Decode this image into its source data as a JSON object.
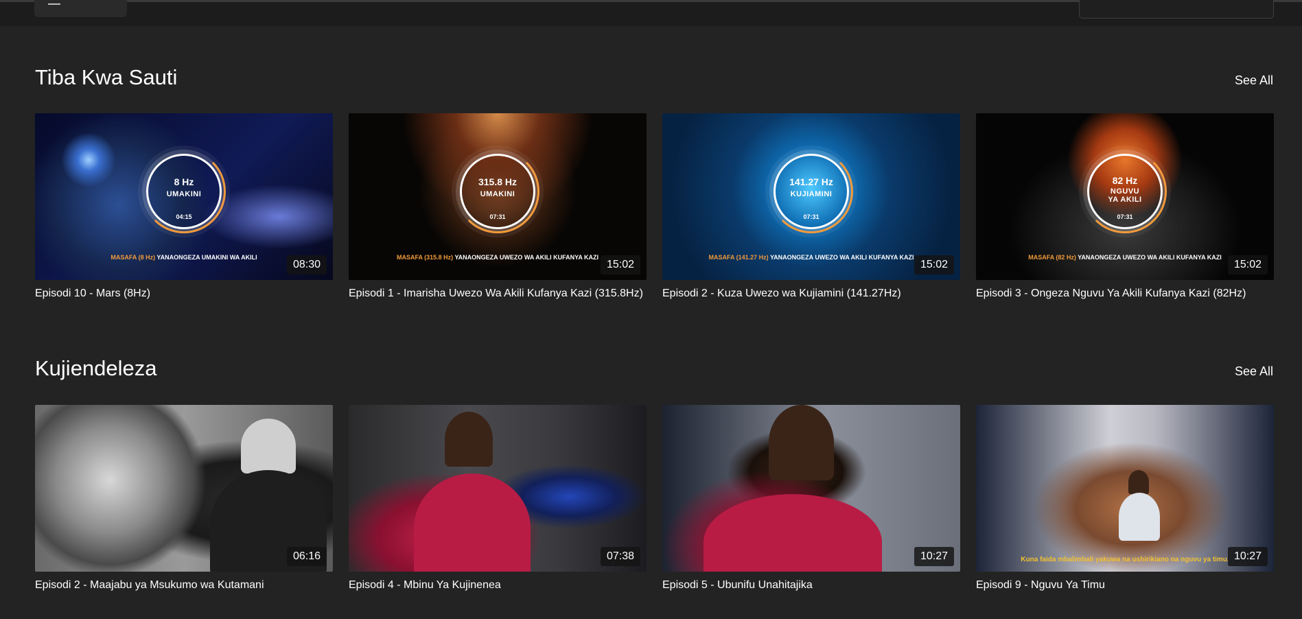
{
  "sections": [
    {
      "title": "Tiba Kwa Sauti",
      "see_all": "See All",
      "items": [
        {
          "title": "Episodi 10 - Mars (8Hz)",
          "duration": "08:30",
          "thumb": {
            "hz": "8 Hz",
            "label": "UMAKINI",
            "time": "04:15",
            "caption_hl": "MASAFA (8 Hz)",
            "caption": "YANAONGEZA UMAKINI WA AKILI"
          }
        },
        {
          "title": "Episodi 1 - Imarisha Uwezo Wa Akili Kufanya Kazi (315.8Hz)",
          "duration": "15:02",
          "thumb": {
            "hz": "315.8 Hz",
            "label": "UMAKINI",
            "time": "07:31",
            "caption_hl": "MASAFA (315.8 Hz)",
            "caption": "YANAONGEZA UWEZO WA AKILI KUFANYA KAZI"
          }
        },
        {
          "title": "Episodi 2 - Kuza Uwezo wa Kujiamini (141.27Hz)",
          "duration": "15:02",
          "thumb": {
            "hz": "141.27 Hz",
            "label": "KUJIAMINI",
            "time": "07:31",
            "caption_hl": "MASAFA (141.27 Hz)",
            "caption": "YANAONGEZA UWEZO WA AKILI KUFANYA KAZI"
          }
        },
        {
          "title": "Episodi 3 - Ongeza Nguvu Ya Akili Kufanya Kazi (82Hz)",
          "duration": "15:02",
          "thumb": {
            "hz": "82 Hz",
            "label": "NGUVU YA AKILI",
            "time": "07:31",
            "caption_hl": "MASAFA (82 Hz)",
            "caption": "YANAONGEZA UWEZO WA AKILI KUFANYA KAZI"
          }
        }
      ]
    },
    {
      "title": "Kujiendeleza",
      "see_all": "See All",
      "items": [
        {
          "title": "Episodi 2 - Maajabu ya Msukumo wa Kutamani",
          "duration": "06:16"
        },
        {
          "title": "Episodi 4 - Mbinu Ya Kujinenea",
          "duration": "07:38"
        },
        {
          "title": "Episodi 5 - Ubunifu Unahitajika",
          "duration": "10:27"
        },
        {
          "title": "Episodi 9 - Nguvu Ya Timu",
          "duration": "10:27",
          "subtitle": "Kuna faida mbalimbali yakuwa na ushirikiano na nguvu ya timu."
        }
      ]
    }
  ],
  "colors": {
    "background": "#232323",
    "accent_orange": "#f29a3b",
    "subtitle_yellow": "#f2c032"
  }
}
